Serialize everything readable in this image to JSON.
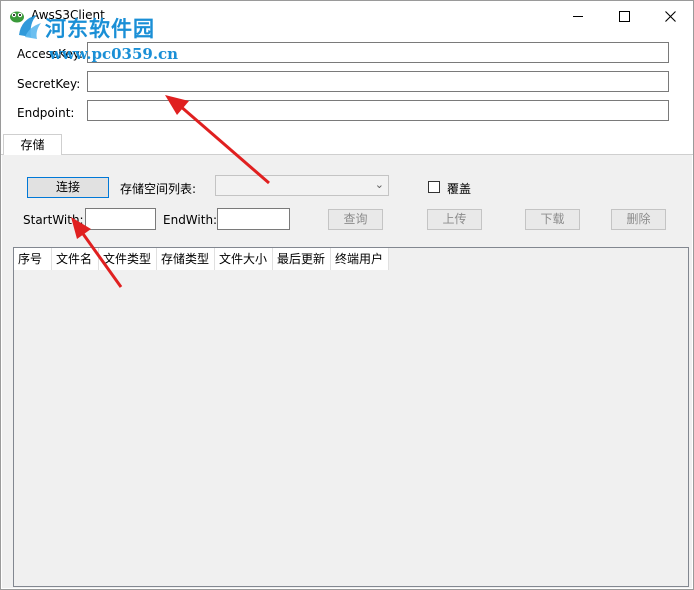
{
  "window": {
    "title": "AwsS3Client"
  },
  "watermark": {
    "site_name": "河东软件园",
    "url": "www.pc0359.cn"
  },
  "form": {
    "access_key_label": "AccessKey:",
    "access_key_value": "",
    "secret_key_label": "SecretKey:",
    "secret_key_value": "",
    "endpoint_label": "Endpoint:",
    "endpoint_value": ""
  },
  "tabs": [
    {
      "label": "存储"
    }
  ],
  "storage": {
    "connect_label": "连接",
    "bucket_list_label": "存储空间列表:",
    "bucket_selected": "",
    "overwrite_label": "覆盖",
    "overwrite_checked": false,
    "start_with_label": "StartWith:",
    "start_with_value": "",
    "end_with_label": "EndWith:",
    "end_with_value": "",
    "query_label": "查询",
    "upload_label": "上传",
    "download_label": "下载",
    "delete_label": "删除"
  },
  "table": {
    "columns": [
      "序号",
      "文件名",
      "文件类型",
      "存储类型",
      "文件大小",
      "最后更新",
      "终端用户"
    ],
    "rows": []
  },
  "colors": {
    "annotation_arrow": "#e02020",
    "watermark": "#1a8fd6",
    "accent": "#0078d7"
  }
}
